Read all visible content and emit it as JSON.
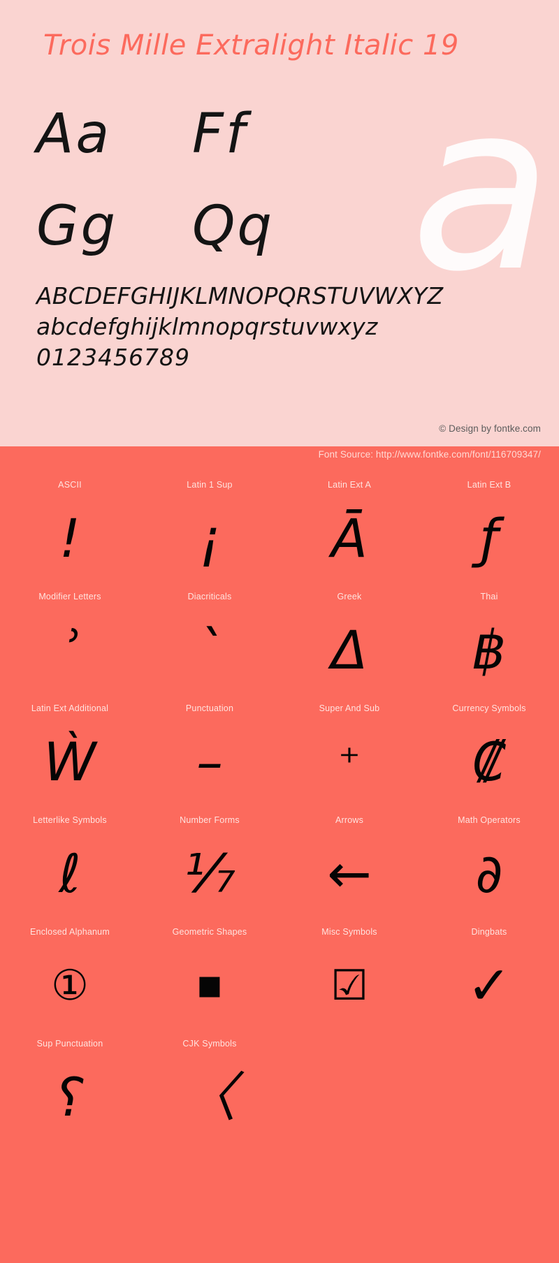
{
  "specimen": {
    "title": "Trois Mille Extralight Italic 19",
    "watermark_glyph": "a",
    "letter_pairs": [
      [
        "Aa",
        "Ff"
      ],
      [
        "Gg",
        "Qq"
      ]
    ],
    "alphabet_uppercase": "ABCDEFGHIJKLMNOPQRSTUVWXYZ",
    "alphabet_lowercase": "abcdefghijklmnopqrstuvwxyz",
    "digits": "0123456789",
    "copyright": "© Design by fontke.com",
    "font_source": "Font Source: http://www.fontke.com/font/116709347/"
  },
  "colors": {
    "panel_background": "#fad4d1",
    "accent_background": "#fc6a5d",
    "title_color": "#fc6a5d",
    "glyph_color": "#050505",
    "label_color": "#ffe3df",
    "watermark_color": "#ffffff",
    "copyright_color": "#5c5c5c"
  },
  "unicode_blocks": [
    {
      "label": "ASCII",
      "glyph": "!",
      "size": "normal"
    },
    {
      "label": "Latin 1 Sup",
      "glyph": "¡",
      "size": "normal"
    },
    {
      "label": "Latin Ext A",
      "glyph": "Ā",
      "size": "normal"
    },
    {
      "label": "Latin Ext B",
      "glyph": "ƒ",
      "size": "normal"
    },
    {
      "label": "Modifier Letters",
      "glyph": "ʾ",
      "size": "normal"
    },
    {
      "label": "Diacriticals",
      "glyph": "ˋ",
      "size": "normal"
    },
    {
      "label": "Greek",
      "glyph": "Δ",
      "size": "normal"
    },
    {
      "label": "Thai",
      "glyph": "฿",
      "size": "normal"
    },
    {
      "label": "Latin Ext Additional",
      "glyph": "Ẁ",
      "size": "normal"
    },
    {
      "label": "Punctuation",
      "glyph": "–",
      "size": "normal"
    },
    {
      "label": "Super And Sub",
      "glyph": "⁺",
      "size": "small"
    },
    {
      "label": "Currency Symbols",
      "glyph": "₡",
      "size": "normal"
    },
    {
      "label": "Letterlike Symbols",
      "glyph": "ℓ",
      "size": "normal"
    },
    {
      "label": "Number Forms",
      "glyph": "⅐",
      "size": "normal"
    },
    {
      "label": "Arrows",
      "glyph": "←",
      "size": "normal"
    },
    {
      "label": "Math Operators",
      "glyph": "∂",
      "size": "normal"
    },
    {
      "label": "Enclosed Alphanum",
      "glyph": "①",
      "size": "small",
      "upright": true
    },
    {
      "label": "Geometric Shapes",
      "glyph": "■",
      "size": "small",
      "upright": true
    },
    {
      "label": "Misc Symbols",
      "glyph": "☑",
      "size": "small",
      "upright": true
    },
    {
      "label": "Dingbats",
      "glyph": "✓",
      "size": "normal",
      "upright": true
    },
    {
      "label": "Sup Punctuation",
      "glyph": "⸮",
      "size": "normal"
    },
    {
      "label": "CJK Symbols",
      "glyph": "〈",
      "size": "normal"
    },
    {
      "label": "",
      "glyph": "",
      "size": "normal"
    },
    {
      "label": "",
      "glyph": "",
      "size": "normal"
    }
  ]
}
